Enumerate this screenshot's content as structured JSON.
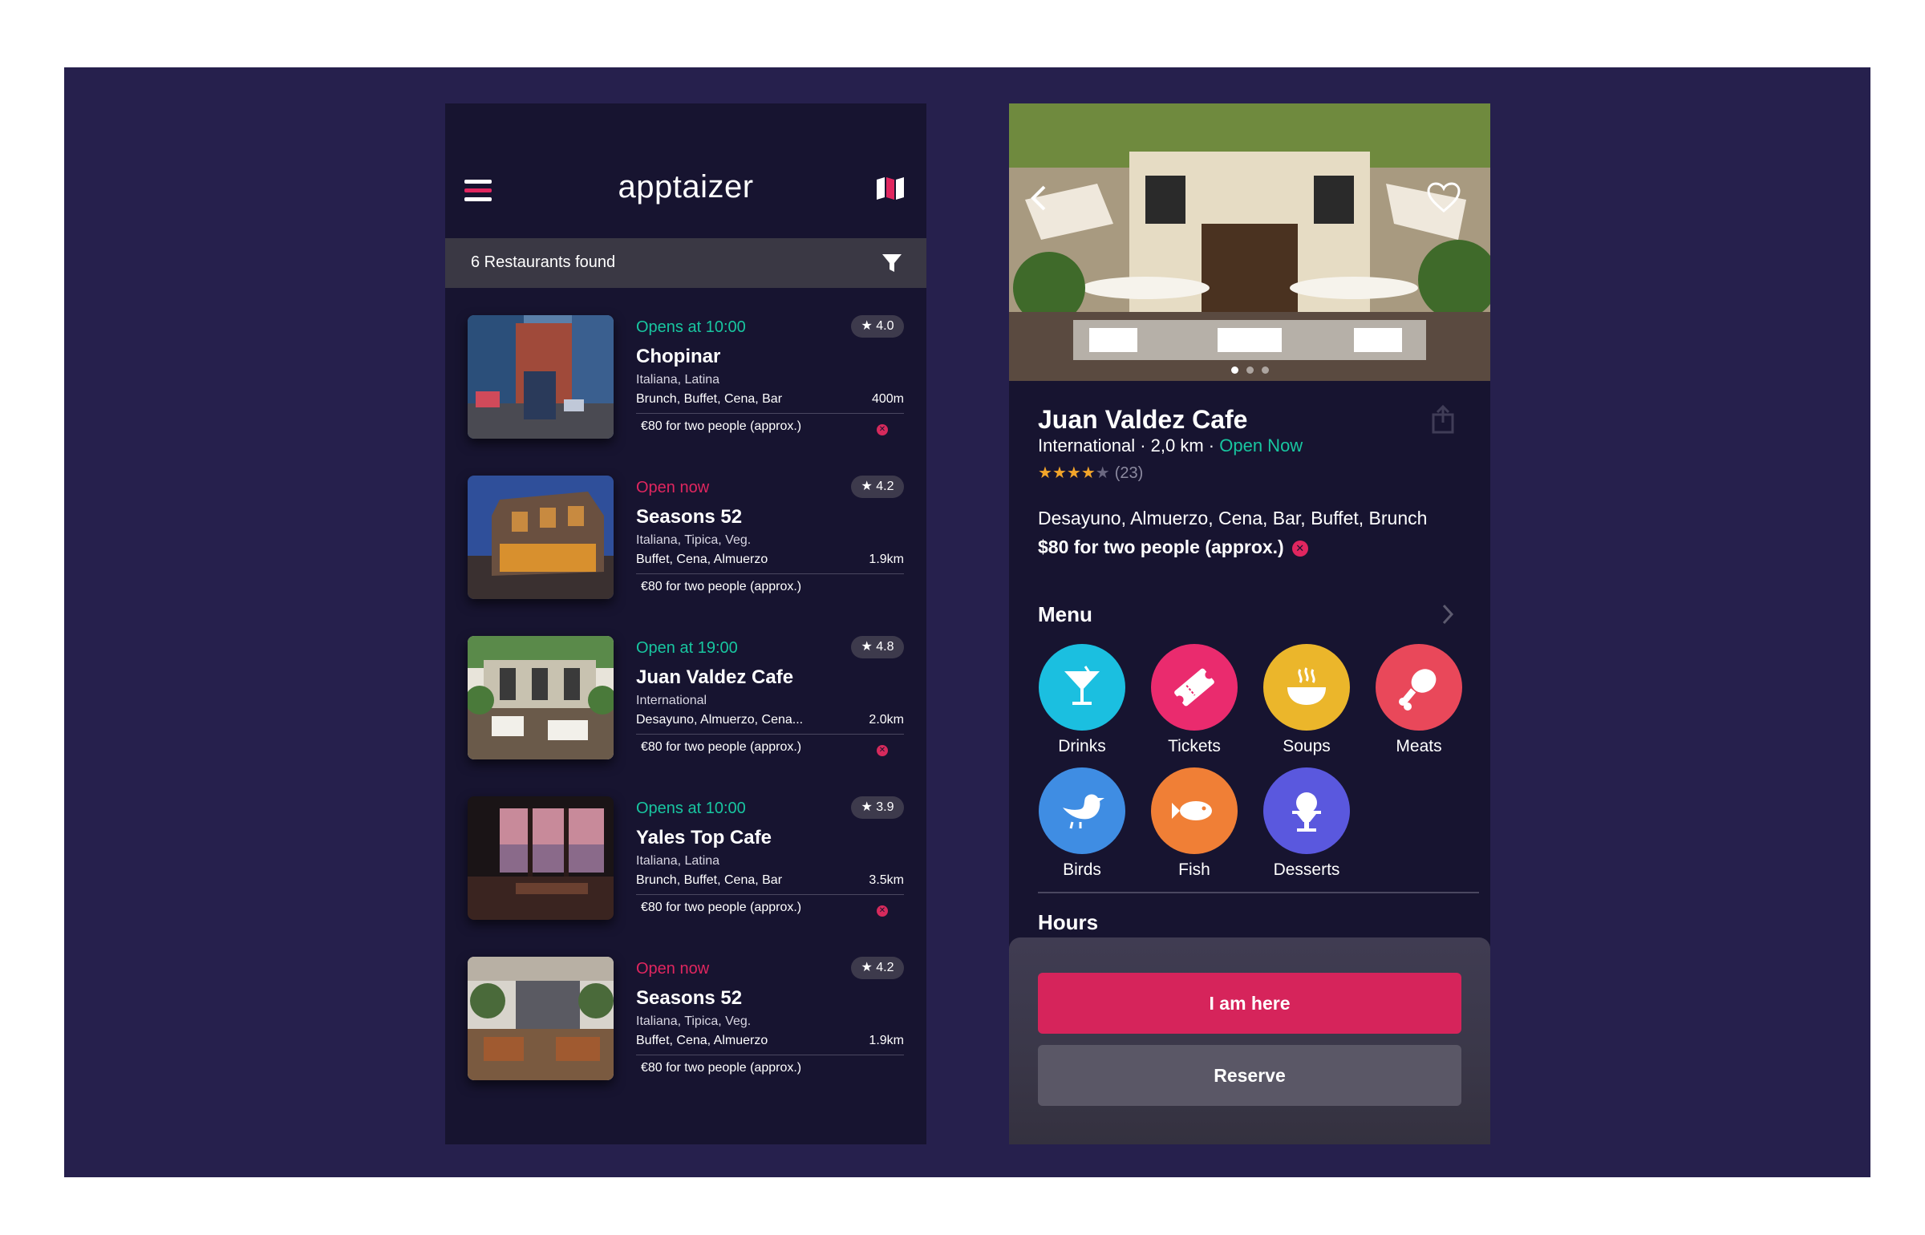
{
  "colors": {
    "background": "#26204d",
    "phone_bg": "#171430",
    "accent_green": "#18c6a0",
    "accent_pink": "#e0265f",
    "star": "#f2a52a"
  },
  "list_screen": {
    "brand": "apptaizer",
    "menu_icon": "hamburger-icon",
    "map_icon": "map-icon",
    "filter_icon": "filter-icon",
    "results_count": "6 Restaurants found",
    "restaurants": [
      {
        "status": "Opens at 10:00",
        "status_color": "#18c6a0",
        "rating": "★ 4.0",
        "name": "Chopinar",
        "cuisine": "Italiana, Latina",
        "tags": "Brunch, Buffet, Cena, Bar",
        "distance": "400m",
        "price": "€80 for two people (approx.)",
        "badge": true
      },
      {
        "status": "Open now",
        "status_color": "#e0265f",
        "rating": "★ 4.2",
        "name": "Seasons 52",
        "cuisine": "Italiana, Tipica, Veg.",
        "tags": "Buffet, Cena, Almuerzo",
        "distance": "1.9km",
        "price": "€80 for two people (approx.)",
        "badge": false
      },
      {
        "status": "Open at 19:00",
        "status_color": "#18c6a0",
        "rating": "★ 4.8",
        "name": "Juan Valdez Cafe",
        "cuisine": "International",
        "tags": "Desayuno, Almuerzo, Cena...",
        "distance": "2.0km",
        "price": "€80 for two people (approx.)",
        "badge": true
      },
      {
        "status": "Opens at 10:00",
        "status_color": "#18c6a0",
        "rating": "★ 3.9",
        "name": "Yales Top Cafe",
        "cuisine": "Italiana, Latina",
        "tags": "Brunch, Buffet, Cena, Bar",
        "distance": "3.5km",
        "price": "€80 for two people (approx.)",
        "badge": true
      },
      {
        "status": "Open now",
        "status_color": "#e0265f",
        "rating": "★ 4.2",
        "name": "Seasons 52",
        "cuisine": "Italiana, Tipica, Veg.",
        "tags": "Buffet, Cena, Almuerzo",
        "distance": "1.9km",
        "price": "€80 for two people (approx.)",
        "badge": false
      }
    ]
  },
  "detail_screen": {
    "name": "Juan Valdez Cafe",
    "cuisine": "International",
    "distance": "2,0 km",
    "separator": " · ",
    "open_status": "Open Now",
    "stars_filled": 4,
    "stars_total": 5,
    "review_count": "(23)",
    "tags": "Desayuno, Almuerzo, Cena, Bar, Buffet, Brunch",
    "price": "$80 for two people (approx.)",
    "menu_title": "Menu",
    "menu_items": [
      {
        "label": "Drinks",
        "color": "#1bbfe0",
        "icon": "cocktail-icon"
      },
      {
        "label": "Tickets",
        "color": "#ea2b6e",
        "icon": "ticket-icon"
      },
      {
        "label": "Soups",
        "color": "#ebb62b",
        "icon": "soup-bowl-icon"
      },
      {
        "label": "Meats",
        "color": "#e9485a",
        "icon": "drumstick-icon"
      },
      {
        "label": "Birds",
        "color": "#3f8de3",
        "icon": "bird-icon"
      },
      {
        "label": "Fish",
        "color": "#f07f36",
        "icon": "fish-icon"
      },
      {
        "label": "Desserts",
        "color": "#5a58de",
        "icon": "ice-cream-icon"
      }
    ],
    "hours_title": "Hours",
    "primary_button": "I am here",
    "secondary_button": "Reserve"
  }
}
